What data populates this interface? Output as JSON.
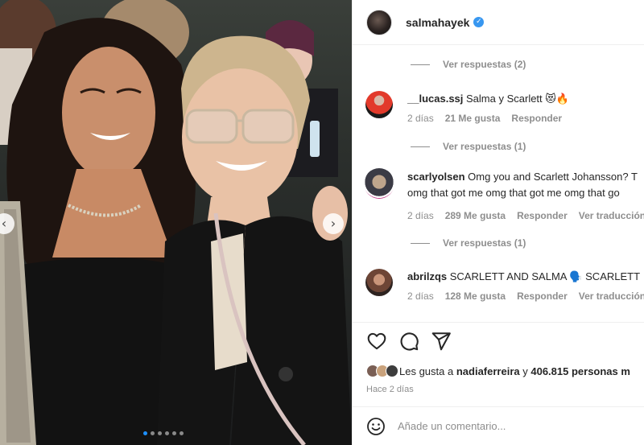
{
  "post": {
    "username": "salmahayek",
    "verified_icon": "verified-badge-icon",
    "photo_alt": "Photo of two women smiling",
    "carousel": {
      "count": 6,
      "active_index": 0
    }
  },
  "comments": {
    "items": [
      {
        "replies_label": "Ver respuestas (2)"
      },
      {
        "username": "__lucas.ssj",
        "text": "Salma y Scarlett 😻🔥",
        "time": "2 días",
        "likes": "21 Me gusta",
        "reply": "Responder"
      },
      {
        "replies_label": "Ver respuestas (1)"
      },
      {
        "username": "scarlyolsen",
        "text": "Omg you and Scarlett Johansson? T",
        "text_line2": "omg that got me omg that got me omg that go",
        "time": "2 días",
        "likes": "289 Me gusta",
        "reply": "Responder",
        "translate": "Ver traducción"
      },
      {
        "replies_label": "Ver respuestas (1)"
      },
      {
        "username": "abrilzqs",
        "text": "SCARLETT AND SALMA 🗣️ SCARLETT",
        "time": "2 días",
        "likes": "128 Me gusta",
        "reply": "Responder",
        "translate": "Ver traducción"
      }
    ]
  },
  "likes": {
    "prefix": "Les gusta a",
    "user": "nadiaferreira",
    "connector": "y",
    "count": "406.815 personas m"
  },
  "posted_time": "Hace 2 días",
  "add_comment": {
    "placeholder": "Añade un comentario..."
  },
  "icons": {
    "like": "heart-icon",
    "comment": "comment-icon",
    "share": "share-icon",
    "emoji": "emoji-icon",
    "prev": "chevron-left-icon",
    "next": "chevron-right-icon"
  },
  "colors": {
    "link": "#3897f0",
    "muted": "#8e8e8e",
    "text": "#262626",
    "carousel_active": "#1e90ff"
  }
}
